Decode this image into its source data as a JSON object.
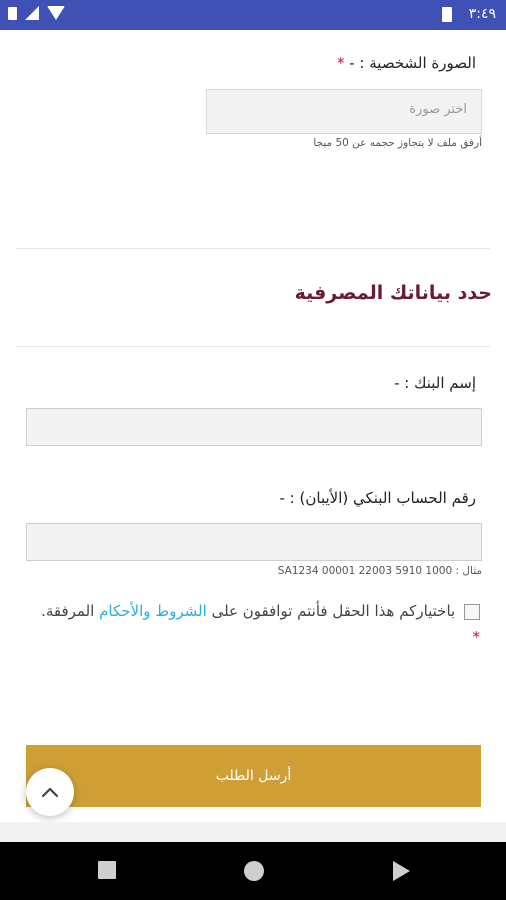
{
  "status_bar": {
    "time": "٣:٤٩"
  },
  "form": {
    "photo_label": "الصورة الشخصية : -",
    "required_mark": "*",
    "photo_placeholder": "اختر صورة",
    "photo_hint": "أرفق ملف لا يتجاوز حجمه عن 50 ميجا",
    "bank_section_title": "حدد بياناتك المصرفية",
    "bank_name_label": "إسم البنك : -",
    "iban_label": "رقم الحساب البنكي (الأيبان) : -",
    "iban_example": "مثال : SA1234 00001 22003 5910 1000",
    "terms_prefix": "باختياركم هذا الحقل فأنتم توافقون على",
    "terms_link": "الشروط والأحكام",
    "terms_suffix": "المرفقة.",
    "submit_label": "أرسل الطلب"
  },
  "colors": {
    "status_bar": "#3f51b5",
    "section_title": "#6b1a3a",
    "link": "#29aee0",
    "submit": "#cf9f36",
    "required": "#e4002b"
  },
  "icons": [
    "sim-icon",
    "signal-icon",
    "wifi-icon",
    "battery-icon",
    "chevron-up-icon",
    "nav-recent-icon",
    "nav-home-icon",
    "nav-back-icon"
  ]
}
